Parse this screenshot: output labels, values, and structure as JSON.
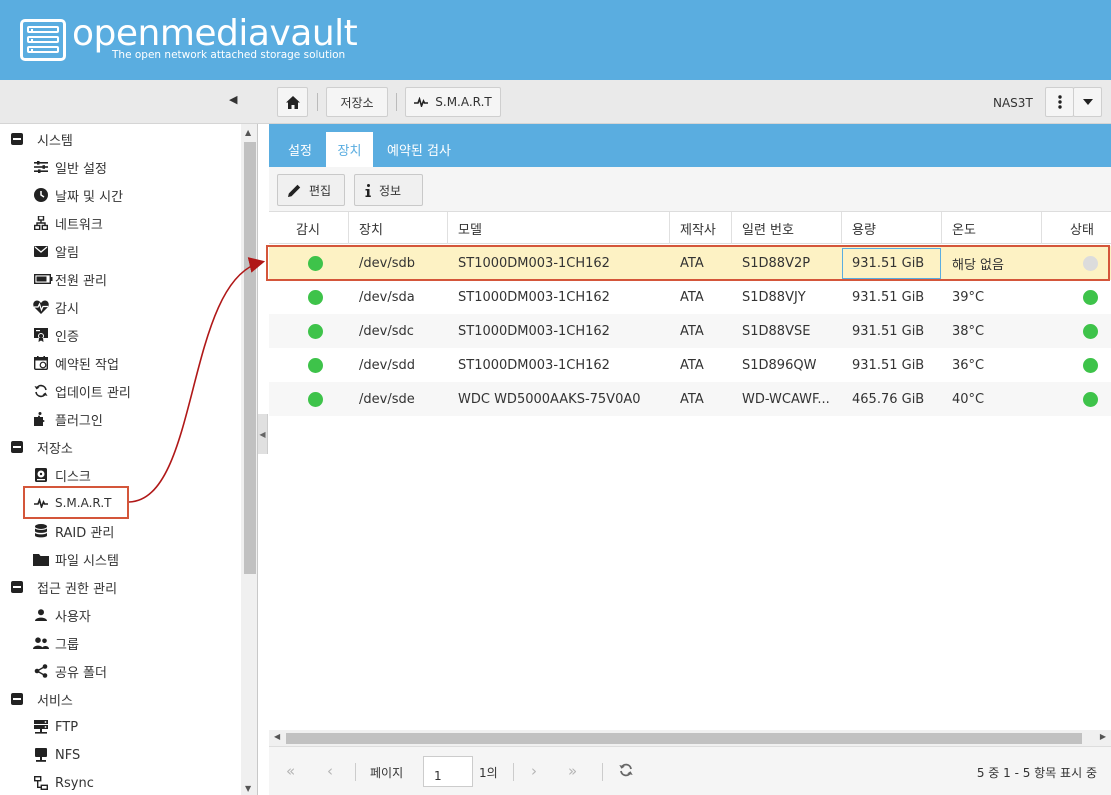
{
  "header": {
    "logo_text": "openmediavault",
    "tagline": "The open network attached storage solution"
  },
  "toolbar": {
    "breadcrumb": [
      "저장소",
      "S.M.A.R.T"
    ],
    "hostname": "NAS3T"
  },
  "sidebar": {
    "groups": [
      {
        "label": "시스템",
        "items": [
          {
            "label": "일반 설정",
            "icon": "sliders-icon"
          },
          {
            "label": "날짜 및 시간",
            "icon": "clock-icon"
          },
          {
            "label": "네트워크",
            "icon": "network-icon"
          },
          {
            "label": "알림",
            "icon": "mail-icon"
          },
          {
            "label": "전원 관리",
            "icon": "battery-icon"
          },
          {
            "label": "감시",
            "icon": "heartbeat-icon"
          },
          {
            "label": "인증",
            "icon": "certificate-icon"
          },
          {
            "label": "예약된 작업",
            "icon": "calendar-icon"
          },
          {
            "label": "업데이트 관리",
            "icon": "refresh-icon"
          },
          {
            "label": "플러그인",
            "icon": "puzzle-icon"
          }
        ]
      },
      {
        "label": "저장소",
        "items": [
          {
            "label": "디스크",
            "icon": "disk-icon"
          },
          {
            "label": "S.M.A.R.T",
            "icon": "pulse-icon"
          },
          {
            "label": "RAID 관리",
            "icon": "database-icon"
          },
          {
            "label": "파일 시스템",
            "icon": "folder-icon"
          }
        ]
      },
      {
        "label": "접근 권한 관리",
        "items": [
          {
            "label": "사용자",
            "icon": "user-icon"
          },
          {
            "label": "그룹",
            "icon": "users-icon"
          },
          {
            "label": "공유 폴더",
            "icon": "share-icon"
          }
        ]
      },
      {
        "label": "서비스",
        "items": [
          {
            "label": "FTP",
            "icon": "server-icon"
          },
          {
            "label": "NFS",
            "icon": "desktop-icon"
          },
          {
            "label": "Rsync",
            "icon": "sitemap-icon"
          }
        ]
      }
    ]
  },
  "tabs": [
    "설정",
    "장치",
    "예약된 검사"
  ],
  "active_tab": "장치",
  "actions": {
    "edit": "편집",
    "info": "정보"
  },
  "grid": {
    "columns": [
      "감시",
      "장치",
      "모델",
      "제작사",
      "일련 번호",
      "용량",
      "온도",
      "상태"
    ],
    "rows": [
      {
        "monitor": "on",
        "device": "/dev/sdb",
        "model": "ST1000DM003-1CH162",
        "vendor": "ATA",
        "serial": "S1D88V2P",
        "capacity": "931.51 GiB",
        "temp": "해당 없음",
        "status": "off"
      },
      {
        "monitor": "on",
        "device": "/dev/sda",
        "model": "ST1000DM003-1CH162",
        "vendor": "ATA",
        "serial": "S1D88VJY",
        "capacity": "931.51 GiB",
        "temp": "39°C",
        "status": "on"
      },
      {
        "monitor": "on",
        "device": "/dev/sdc",
        "model": "ST1000DM003-1CH162",
        "vendor": "ATA",
        "serial": "S1D88VSE",
        "capacity": "931.51 GiB",
        "temp": "38°C",
        "status": "on"
      },
      {
        "monitor": "on",
        "device": "/dev/sdd",
        "model": "ST1000DM003-1CH162",
        "vendor": "ATA",
        "serial": "S1D896QW",
        "capacity": "931.51 GiB",
        "temp": "36°C",
        "status": "on"
      },
      {
        "monitor": "on",
        "device": "/dev/sde",
        "model": "WDC WD5000AAKS-75V0A0",
        "vendor": "ATA",
        "serial": "WD-WCAWF...",
        "capacity": "465.76 GiB",
        "temp": "40°C",
        "status": "on"
      }
    ]
  },
  "pager": {
    "page_label": "페이지",
    "page_value": "1",
    "of_label": "1의",
    "summary": "5 중 1 - 5 항목 표시 중"
  },
  "colors": {
    "accent": "#5aade0",
    "status_on": "#3ec34a",
    "highlight": "#d4563a",
    "selected_row": "#fdf2c4"
  }
}
